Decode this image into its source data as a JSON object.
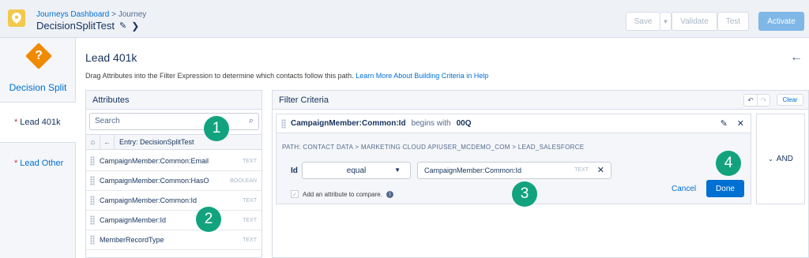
{
  "header": {
    "breadcrumb_link": "Journeys Dashboard",
    "breadcrumb_sep": ">",
    "breadcrumb_current": "Journey",
    "title": "DecisionSplitTest",
    "save": "Save",
    "validate": "Validate",
    "test": "Test",
    "activate": "Activate"
  },
  "leftnav": {
    "activity_label": "Decision Split",
    "activity_icon": "?",
    "items": [
      {
        "label": "Lead 401k",
        "required": "*",
        "active": true
      },
      {
        "label": "Lead Other",
        "required": "*",
        "active": false
      }
    ]
  },
  "main": {
    "title": "Lead 401k",
    "description": "Drag Attributes into the Filter Expression to determine which contacts follow this path.",
    "help_link": "Learn More About Building Criteria in Help"
  },
  "attributes": {
    "heading": "Attributes",
    "search_placeholder": "Search",
    "entry_label": "Entry: DecisionSplitTest",
    "items": [
      {
        "name": "CampaignMember:Common:Email",
        "type": "TEXT"
      },
      {
        "name": "CampaignMember:Common:HasO",
        "type": "BOOLEAN"
      },
      {
        "name": "CampaignMember:Common:Id",
        "type": "TEXT"
      },
      {
        "name": "CampaignMember:Id",
        "type": "TEXT"
      },
      {
        "name": "MemberRecordType",
        "type": "TEXT"
      }
    ]
  },
  "filter": {
    "heading": "Filter Criteria",
    "clear": "Clear",
    "criterion": {
      "attribute": "CampaignMember:Common:Id",
      "operator_text": "begins with",
      "value": "00Q",
      "path": "PATH: CONTACT DATA > MARKETING CLOUD APIUSER_MCDEMO_COM > LEAD_SALESFORCE",
      "field_label": "Id",
      "operator": "equal",
      "compare_value": "CampaignMember:Common:Id",
      "compare_type": "TEXT",
      "checkbox_label": "Add an attribute to compare.",
      "checkbox_checked": true,
      "cancel": "Cancel",
      "done": "Done"
    },
    "logic": "AND"
  },
  "callouts": [
    "1",
    "2",
    "3",
    "4"
  ],
  "colors": {
    "accent": "#0070d2",
    "callout": "#12a37e",
    "decision": "#f08a00"
  }
}
